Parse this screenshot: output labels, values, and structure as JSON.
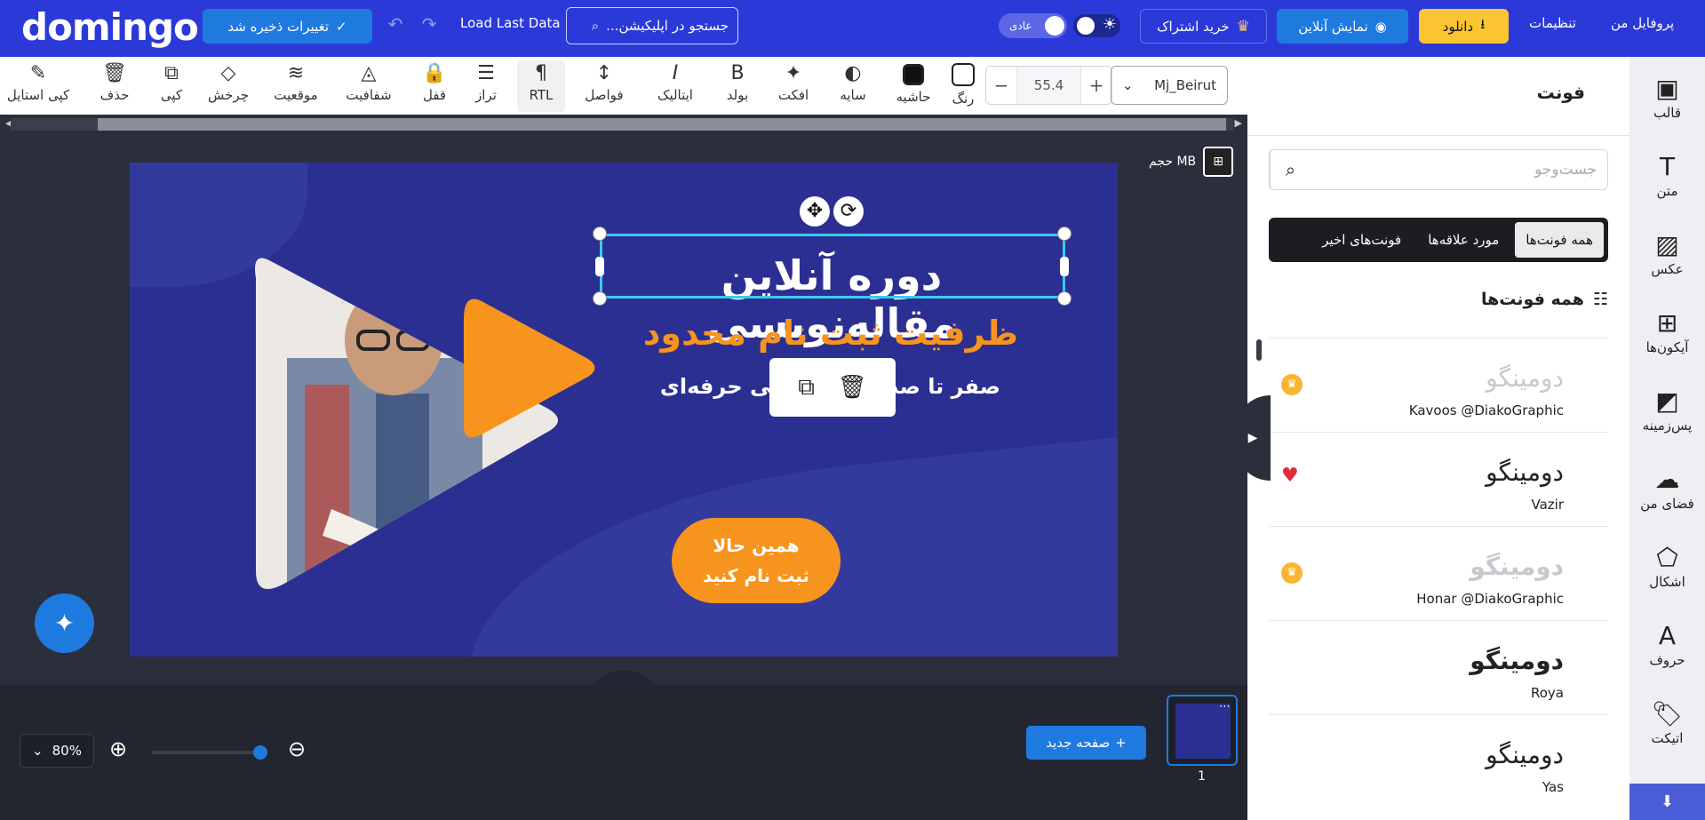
{
  "topbar": {
    "logo": "domingo",
    "saved_label": "تغییرات ذخیره شد",
    "load_last": "Load Last Data",
    "search_placeholder": "جستجو در اپلیکیشن...",
    "theme_mode": "عادی",
    "subscribe": "خرید اشتراک",
    "online_preview": "نمایش آنلاین",
    "download": "دانلود",
    "settings": "تنظیمات",
    "profile": "پروفایل من"
  },
  "toolbar": {
    "font_name": "Mj_Beirut",
    "font_size": "55.4",
    "tools": [
      "رنگ",
      "حاشیه",
      "سایه",
      "افکت",
      "بولد",
      "ایتالیک",
      "فواصل",
      "RTL",
      "تراز",
      "قفل",
      "شفافیت",
      "موقعیت",
      "چرخش",
      "کپی",
      "حذف",
      "کپی استایل"
    ]
  },
  "canvas": {
    "size_label": "حجم MB",
    "headline": "دوره آنلاین مقاله‌نویسی",
    "subline": "ظرفیت ثبت نام محدود",
    "smalline": "صفر تا صد مقاله‌نویسی حرفه‌ای",
    "cta_line1": "همین حالا",
    "cta_line2": "ثبت نام کنید",
    "colors": {
      "bg": "#2c2f92",
      "accent": "#f7941d",
      "selection": "#3fc8f0"
    }
  },
  "bottom": {
    "zoom": "80%",
    "new_page": "صفحه جدید",
    "page_number": "1"
  },
  "panel": {
    "title": "فونت",
    "search_placeholder": "جست‌وجو",
    "tabs": [
      "همه فونت‌ها",
      "مورد علاقه‌ها",
      "فونت‌های اخیر"
    ],
    "section_title": "همه فونت‌ها",
    "fonts": [
      {
        "sample": "دومینگو",
        "name": "Kavoos @DiakoGraphic",
        "marker": "premium"
      },
      {
        "sample": "دومینگو",
        "name": "Vazir",
        "marker": "favorite"
      },
      {
        "sample": "دومینگو",
        "name": "Honar @DiakoGraphic",
        "marker": "premium"
      },
      {
        "sample": "دومینگو",
        "name": "Roya",
        "marker": ""
      },
      {
        "sample": "دومینگو",
        "name": "Yas",
        "marker": ""
      }
    ]
  },
  "rail": {
    "items": [
      "قالب",
      "متن",
      "عکس",
      "آیکون‌ها",
      "پس‌زمینه",
      "فضای من",
      "اشکال",
      "حروف",
      "اتیکت"
    ]
  }
}
